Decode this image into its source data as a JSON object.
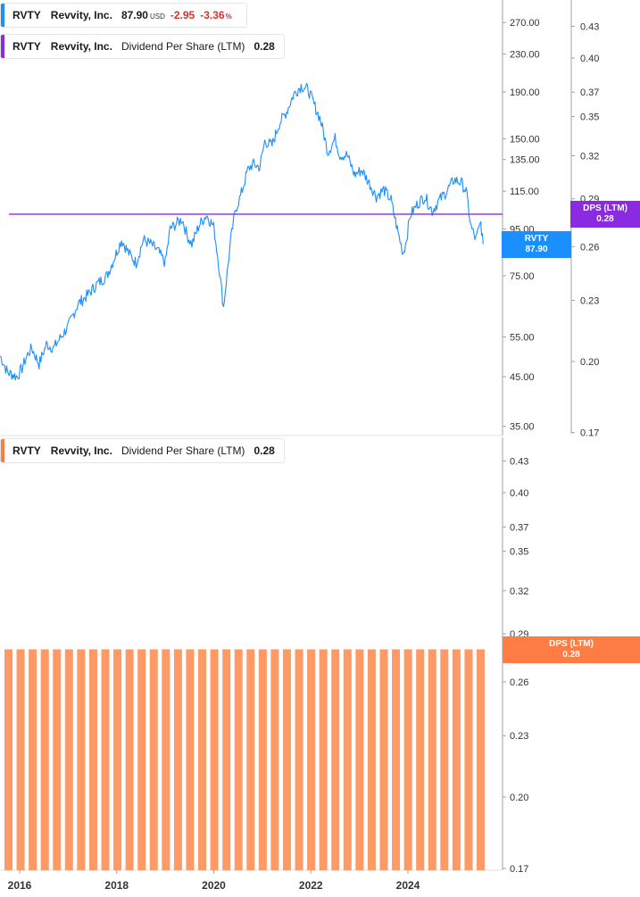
{
  "legend_price": {
    "ticker": "RVTY",
    "name": "Revvity, Inc.",
    "price": "87.90",
    "currency": "USD",
    "change": "-2.95",
    "change_pct": "-3.36",
    "pct_sign": "%",
    "color": "#1a8fff"
  },
  "legend_dps_top": {
    "ticker": "RVTY",
    "name": "Revvity, Inc.",
    "metric": "Dividend Per Share (LTM)",
    "value": "0.28",
    "color": "#8a2be2"
  },
  "legend_dps_bottom": {
    "ticker": "RVTY",
    "name": "Revvity, Inc.",
    "metric": "Dividend Per Share (LTM)",
    "value": "0.28",
    "color": "#ff7d45"
  },
  "tags": {
    "dps_top_label": "DPS (LTM)",
    "dps_top_value": "0.28",
    "rvty_label": "RVTY",
    "rvty_value": "87.90",
    "dps_bottom_label": "DPS (LTM)",
    "dps_bottom_value": "0.28"
  },
  "chart_data": [
    {
      "type": "line",
      "scale": "log",
      "series": [
        {
          "name": "RVTY",
          "x": [
            2015.6,
            2015.75,
            2015.95,
            2016.05,
            2016.15,
            2016.25,
            2016.4,
            2016.55,
            2016.7,
            2016.85,
            2017.0,
            2017.2,
            2017.4,
            2017.6,
            2017.8,
            2017.95,
            2018.1,
            2018.25,
            2018.4,
            2018.55,
            2018.7,
            2018.85,
            2019.0,
            2019.1,
            2019.25,
            2019.35,
            2019.45,
            2019.55,
            2019.7,
            2019.85,
            2020.0,
            2020.1,
            2020.2,
            2020.35,
            2020.45,
            2020.55,
            2020.7,
            2020.8,
            2020.95,
            2021.05,
            2021.2,
            2021.35,
            2021.5,
            2021.65,
            2021.8,
            2021.95,
            2022.05,
            2022.2,
            2022.35,
            2022.5,
            2022.6,
            2022.75,
            2022.9,
            2023.05,
            2023.2,
            2023.35,
            2023.5,
            2023.65,
            2023.8,
            2023.9,
            2023.95,
            2024.05,
            2024.2,
            2024.35,
            2024.5,
            2024.65,
            2024.8,
            2024.95,
            2025.1,
            2025.2,
            2025.3,
            2025.4,
            2025.5,
            2025.55
          ],
          "y": [
            50,
            46,
            45,
            47,
            50,
            52,
            48,
            53,
            52,
            55,
            58,
            65,
            68,
            72,
            75,
            82,
            90,
            84,
            80,
            90,
            88,
            85,
            80,
            95,
            98,
            100,
            92,
            88,
            97,
            102,
            96,
            80,
            64,
            90,
            105,
            112,
            128,
            132,
            130,
            148,
            145,
            162,
            172,
            188,
            196,
            192,
            180,
            165,
            140,
            150,
            138,
            138,
            125,
            128,
            120,
            112,
            116,
            110,
            93,
            84,
            88,
            102,
            108,
            112,
            104,
            110,
            115,
            122,
            120,
            115,
            96,
            90,
            98,
            88
          ]
        },
        {
          "name": "Dividend Per Share (LTM)",
          "x": [
            2015.6,
            2025.55
          ],
          "y": [
            0.28,
            0.28
          ]
        }
      ],
      "price_ticks": [
        "270.00",
        "230.00",
        "190.00",
        "150.00",
        "135.00",
        "115.00",
        "95.00",
        "75.00",
        "55.00",
        "45.00",
        "35.00"
      ],
      "dps_ticks": [
        "0.43",
        "0.40",
        "0.37",
        "0.35",
        "0.32",
        "0.29",
        "0.26",
        "0.23",
        "0.20",
        "0.17"
      ]
    },
    {
      "type": "bar",
      "scale": "log",
      "series": [
        {
          "name": "Dividend Per Share (LTM)",
          "values": [
            0.28,
            0.28,
            0.28,
            0.28,
            0.28,
            0.28,
            0.28,
            0.28,
            0.28,
            0.28,
            0.28,
            0.28,
            0.28,
            0.28,
            0.28,
            0.28,
            0.28,
            0.28,
            0.28,
            0.28,
            0.28,
            0.28,
            0.28,
            0.28,
            0.28,
            0.28,
            0.28,
            0.28,
            0.28,
            0.28,
            0.28,
            0.28,
            0.28,
            0.28,
            0.28,
            0.28,
            0.28,
            0.28,
            0.28,
            0.28
          ]
        }
      ],
      "ticks": [
        "0.43",
        "0.40",
        "0.37",
        "0.35",
        "0.32",
        "0.29",
        "0.26",
        "0.23",
        "0.20",
        "0.17"
      ]
    }
  ],
  "x_axis": {
    "labels": [
      "2016",
      "2018",
      "2020",
      "2022",
      "2024"
    ],
    "values": [
      2016,
      2018,
      2020,
      2022,
      2024
    ]
  },
  "colors": {
    "price_line": "#1a8fff",
    "dps_line": "#8a2be2",
    "bars": "#ff9966",
    "axis": "#9aa3ad",
    "text": "#1a1a1a"
  }
}
